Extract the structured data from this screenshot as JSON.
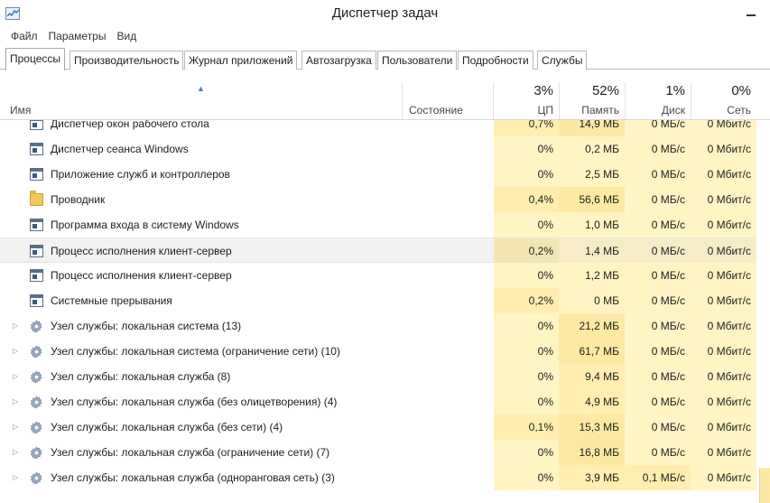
{
  "window": {
    "title": "Диспетчер задач"
  },
  "menu": [
    "Файл",
    "Параметры",
    "Вид"
  ],
  "tabs": [
    {
      "label": "Процессы",
      "active": true
    },
    {
      "label": "Производительность",
      "active": false
    },
    {
      "label": "Журнал приложений",
      "active": false
    },
    {
      "label": "Автозагрузка",
      "active": false
    },
    {
      "label": "Пользователи",
      "active": false
    },
    {
      "label": "Подробности",
      "active": false
    },
    {
      "label": "Службы",
      "active": false
    }
  ],
  "columns": {
    "name": "Имя",
    "status": "Состояние",
    "cpu": {
      "label": "ЦП",
      "percent": "3%"
    },
    "memory": {
      "label": "Память",
      "percent": "52%"
    },
    "disk": {
      "label": "Диск",
      "percent": "1%"
    },
    "network": {
      "label": "Сеть",
      "percent": "0%"
    }
  },
  "rows": [
    {
      "name": "Диспетчер окон рабочего стола",
      "icon": "app-window-icon",
      "expandable": false,
      "cpu": "0,7%",
      "memory": "14,9 МБ",
      "disk": "0 МБ/с",
      "network": "0 Мбит/с",
      "selected": false
    },
    {
      "name": "Диспетчер сеанса  Windows",
      "icon": "app-window-icon",
      "expandable": false,
      "cpu": "0%",
      "memory": "0,2 МБ",
      "disk": "0 МБ/с",
      "network": "0 Мбит/с",
      "selected": false
    },
    {
      "name": "Приложение служб и контроллеров",
      "icon": "app-window-icon",
      "expandable": false,
      "cpu": "0%",
      "memory": "2,5 МБ",
      "disk": "0 МБ/с",
      "network": "0 Мбит/с",
      "selected": false
    },
    {
      "name": "Проводник",
      "icon": "folder-icon",
      "expandable": false,
      "cpu": "0,4%",
      "memory": "56,6 МБ",
      "disk": "0 МБ/с",
      "network": "0 Мбит/с",
      "selected": false
    },
    {
      "name": "Программа входа в систему Windows",
      "icon": "app-window-icon",
      "expandable": false,
      "cpu": "0%",
      "memory": "1,0 МБ",
      "disk": "0 МБ/с",
      "network": "0 Мбит/с",
      "selected": false
    },
    {
      "name": "Процесс исполнения клиент-сервер",
      "icon": "app-window-icon",
      "expandable": false,
      "cpu": "0,2%",
      "memory": "1,4 МБ",
      "disk": "0 МБ/с",
      "network": "0 Мбит/с",
      "selected": true
    },
    {
      "name": "Процесс исполнения клиент-сервер",
      "icon": "app-window-icon",
      "expandable": false,
      "cpu": "0%",
      "memory": "1,2 МБ",
      "disk": "0 МБ/с",
      "network": "0 Мбит/с",
      "selected": false
    },
    {
      "name": "Системные прерывания",
      "icon": "app-window-icon",
      "expandable": false,
      "cpu": "0,2%",
      "memory": "0 МБ",
      "disk": "0 МБ/с",
      "network": "0 Мбит/с",
      "selected": false
    },
    {
      "name": "Узел службы: локальная система (13)",
      "icon": "gear-icon",
      "expandable": true,
      "cpu": "0%",
      "memory": "21,2 МБ",
      "disk": "0 МБ/с",
      "network": "0 Мбит/с",
      "selected": false
    },
    {
      "name": "Узел службы: локальная система (ограничение сети) (10)",
      "icon": "gear-icon",
      "expandable": true,
      "cpu": "0%",
      "memory": "61,7 МБ",
      "disk": "0 МБ/с",
      "network": "0 Мбит/с",
      "selected": false
    },
    {
      "name": "Узел службы: локальная служба (8)",
      "icon": "gear-icon",
      "expandable": true,
      "cpu": "0%",
      "memory": "9,4 МБ",
      "disk": "0 МБ/с",
      "network": "0 Мбит/с",
      "selected": false
    },
    {
      "name": "Узел службы: локальная служба (без олицетворения) (4)",
      "icon": "gear-icon",
      "expandable": true,
      "cpu": "0%",
      "memory": "4,9 МБ",
      "disk": "0 МБ/с",
      "network": "0 Мбит/с",
      "selected": false
    },
    {
      "name": "Узел службы: локальная служба (без сети) (4)",
      "icon": "gear-icon",
      "expandable": true,
      "cpu": "0,1%",
      "memory": "15,3 МБ",
      "disk": "0 МБ/с",
      "network": "0 Мбит/с",
      "selected": false
    },
    {
      "name": "Узел службы: локальная служба (ограничение сети) (7)",
      "icon": "gear-icon",
      "expandable": true,
      "cpu": "0%",
      "memory": "16,8 МБ",
      "disk": "0 МБ/с",
      "network": "0 Мбит/с",
      "selected": false
    },
    {
      "name": "Узел службы: локальная служба (одноранговая сеть) (3)",
      "icon": "gear-icon",
      "expandable": true,
      "cpu": "0%",
      "memory": "3,9 МБ",
      "disk": "0,1 МБ/с",
      "network": "0 Мбит/с",
      "selected": false
    }
  ],
  "colors": {
    "heat_low": "#fff4c4",
    "heat_mid": "#ffeeb0",
    "heat_high": "#fde9a4",
    "selected_row": "#f2f2f2",
    "sort_arrow": "#4f7fb5"
  }
}
